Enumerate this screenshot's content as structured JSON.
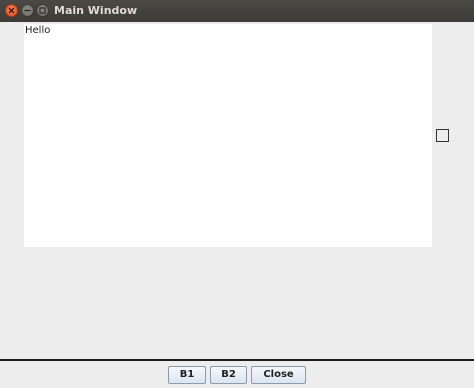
{
  "window": {
    "title": "Main Window",
    "controls": {
      "close": "close-icon",
      "minimize": "minimize-icon",
      "maximize": "maximize-icon"
    }
  },
  "main": {
    "text": "Hello"
  },
  "side_checkbox": {
    "checked": false
  },
  "buttons": {
    "b1_label": "B1",
    "b2_label": "B2",
    "close_label": "Close"
  },
  "colors": {
    "titlebar": "#3c3b37",
    "close_button": "#df4a16",
    "background": "#ededed",
    "content_background": "#ffffff"
  }
}
